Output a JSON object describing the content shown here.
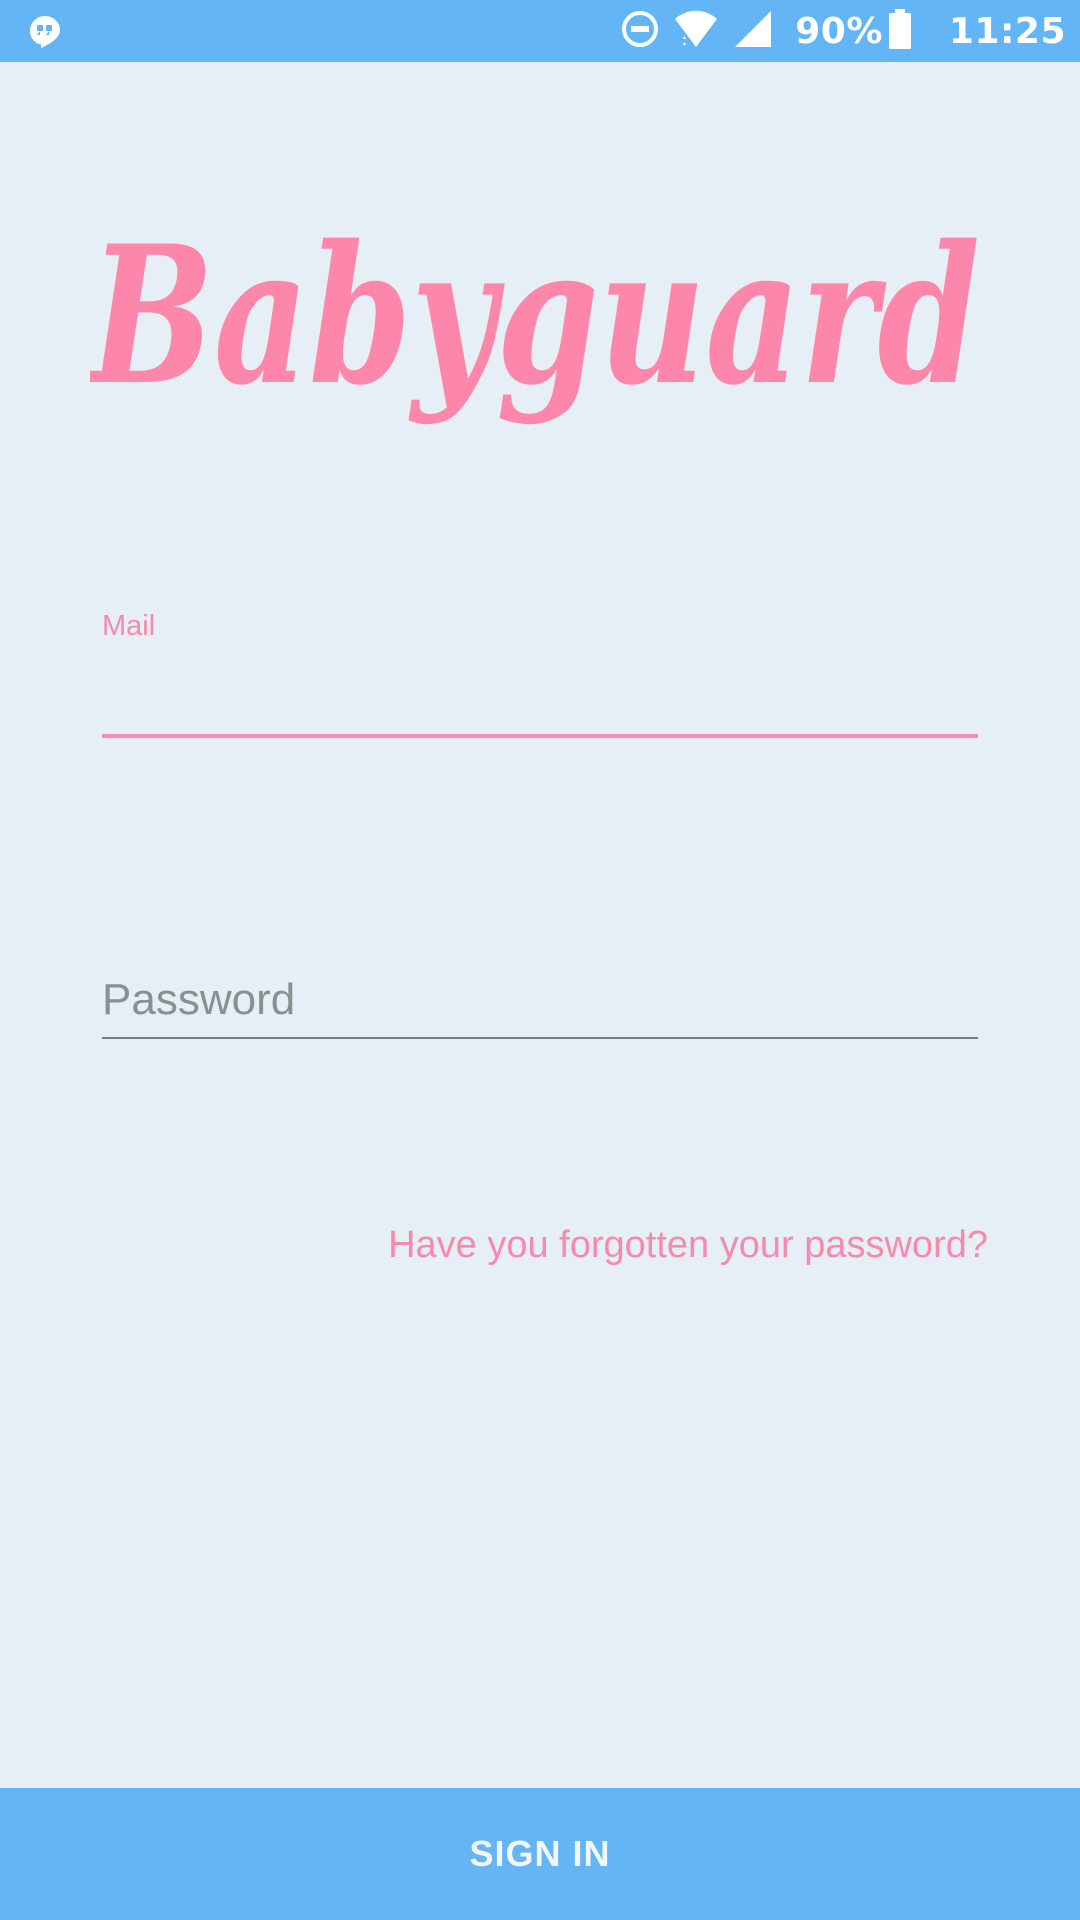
{
  "status_bar": {
    "left_icon": "hangouts-icon",
    "icons": [
      "do-not-disturb-icon",
      "wifi-icon",
      "cellular-signal-icon",
      "battery-icon"
    ],
    "battery": "90%",
    "time": "11:25",
    "color": "#64b5f6"
  },
  "logo": {
    "text": "Babyguard",
    "color": "#fd87aa"
  },
  "form": {
    "mail": {
      "label": "Mail",
      "value": ""
    },
    "password": {
      "placeholder": "Password",
      "value": ""
    },
    "forgot_link": "Have you forgotten your password?"
  },
  "actions": {
    "sign_in_label": "SIGN IN"
  },
  "colors": {
    "background": "#e7eff6",
    "accent": "#f58aac",
    "primary": "#64b5f6"
  }
}
